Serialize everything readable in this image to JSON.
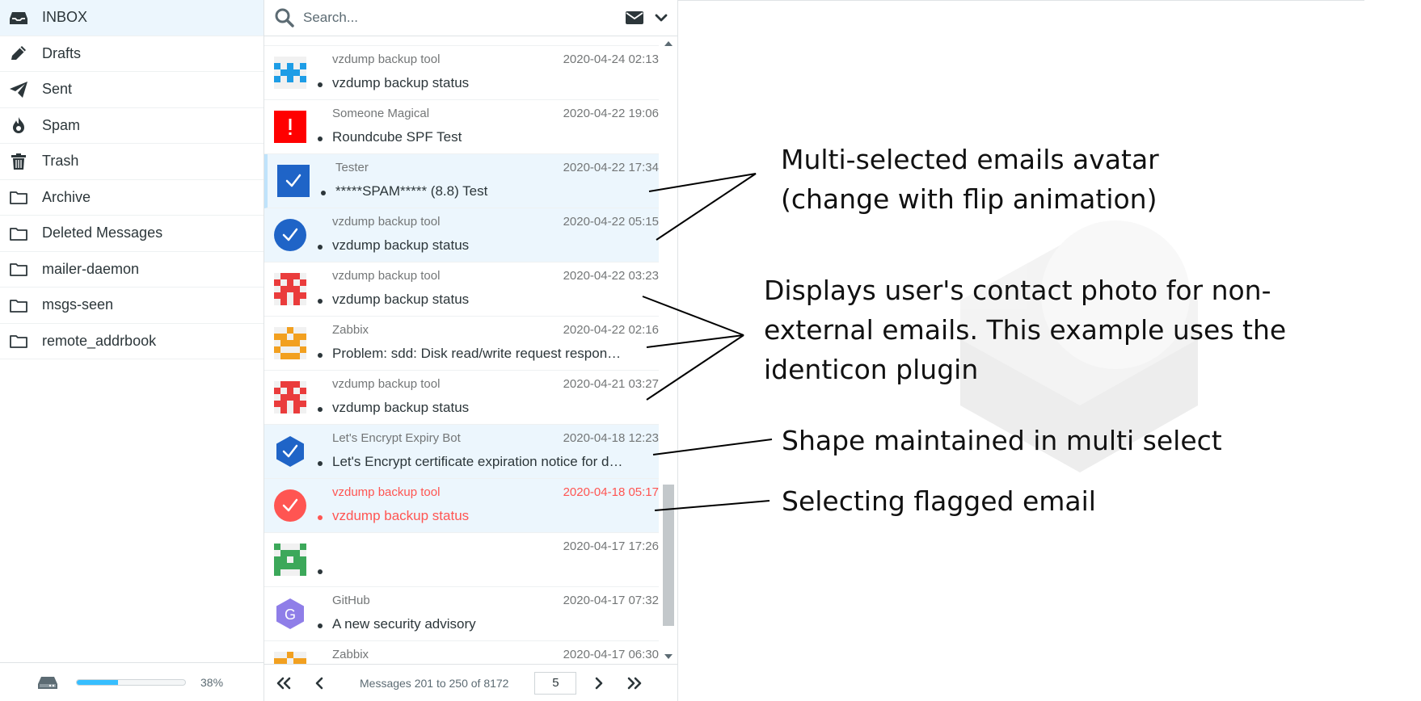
{
  "folders": [
    {
      "label": "INBOX",
      "icon": "inbox-icon",
      "active": true
    },
    {
      "label": "Drafts",
      "icon": "pencil-icon"
    },
    {
      "label": "Sent",
      "icon": "paper-plane-icon"
    },
    {
      "label": "Spam",
      "icon": "fire-icon"
    },
    {
      "label": "Trash",
      "icon": "trash-icon"
    },
    {
      "label": "Archive",
      "icon": "folder-icon"
    },
    {
      "label": "Deleted Messages",
      "icon": "folder-icon"
    },
    {
      "label": "mailer-daemon",
      "icon": "folder-icon"
    },
    {
      "label": "msgs-seen",
      "icon": "folder-icon"
    },
    {
      "label": "remote_addrbook",
      "icon": "folder-icon"
    }
  ],
  "quota": {
    "percent_label": "38%",
    "percent": 38,
    "icon": "hard-drive-icon"
  },
  "search": {
    "placeholder": "Search..."
  },
  "messages": [
    {
      "from": "vzdump backup tool",
      "date": "2020-04-24 02:13",
      "subject": "vzdump backup status",
      "avatar": "identicon-blue"
    },
    {
      "from": "Someone Magical",
      "date": "2020-04-22 19:06",
      "subject": "Roundcube SPF Test",
      "avatar": "red-warning-square"
    },
    {
      "from": "Tester",
      "date": "2020-04-22 17:34",
      "subject": "*****SPAM***** (8.8) Test",
      "avatar": "selected-square",
      "selected": true,
      "focused": true
    },
    {
      "from": "vzdump backup tool",
      "date": "2020-04-22 05:15",
      "subject": "vzdump backup status",
      "avatar": "selected-circle",
      "selected": true
    },
    {
      "from": "vzdump backup tool",
      "date": "2020-04-22 03:23",
      "subject": "vzdump backup status",
      "avatar": "identicon-red"
    },
    {
      "from": "Zabbix",
      "date": "2020-04-22 02:16",
      "subject": "Problem: sdd: Disk read/write request responses are too high",
      "avatar": "identicon-orange"
    },
    {
      "from": "vzdump backup tool",
      "date": "2020-04-21 03:27",
      "subject": "vzdump backup status",
      "avatar": "identicon-red"
    },
    {
      "from": "Let's Encrypt Expiry Bot",
      "date": "2020-04-18 12:23",
      "subject": "Let's Encrypt certificate expiration notice for domain",
      "avatar": "selected-hexagon",
      "selected": true
    },
    {
      "from": "vzdump backup tool",
      "date": "2020-04-18 05:17",
      "subject": "vzdump backup status",
      "avatar": "selected-circle-red",
      "selected": true,
      "flagged": true,
      "right_icon": "flag-icon"
    },
    {
      "from": "",
      "date": "2020-04-17 17:26",
      "subject": "",
      "avatar": "identicon-green",
      "right_icon": "paperclip-icon"
    },
    {
      "from": "GitHub",
      "date": "2020-04-17 07:32",
      "subject": "A new security advisory",
      "avatar": "letter-hexagon",
      "avatar_letter": "G"
    },
    {
      "from": "Zabbix",
      "date": "2020-04-17 06:30",
      "subject": "",
      "avatar": "identicon-orange"
    }
  ],
  "pager": {
    "info": "Messages 201 to 250 of 8172",
    "page": "5"
  },
  "annotations": {
    "multi_selected": [
      "Multi-selected emails avatar",
      "(change with flip animation)"
    ],
    "contact_photo": [
      "Displays user's contact photo for non-",
      "external emails. This example uses the",
      "identicon plugin"
    ],
    "shape": "Shape maintained in multi select",
    "flagged": "Selecting flagged email"
  },
  "colors": {
    "accent": "#37beff",
    "selected_bg": "#ecf6fd",
    "check_blue": "#1f64c7",
    "flag_red": "#ff5552"
  }
}
